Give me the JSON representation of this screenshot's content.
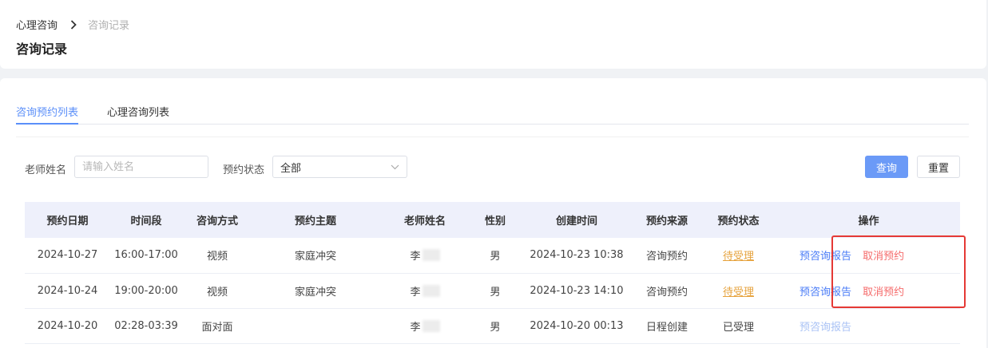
{
  "breadcrumb": {
    "parent": "心理咨询",
    "current": "咨询记录"
  },
  "page_title": "咨询记录",
  "tabs": [
    {
      "label": "咨询预约列表",
      "active": true
    },
    {
      "label": "心理咨询列表",
      "active": false
    }
  ],
  "filters": {
    "teacher_label": "老师姓名",
    "teacher_placeholder": "请输入姓名",
    "teacher_value": "",
    "status_label": "预约状态",
    "status_value": "全部",
    "search_label": "查询",
    "reset_label": "重置"
  },
  "table": {
    "columns": [
      "预约日期",
      "时间段",
      "咨询方式",
      "预约主题",
      "老师姓名",
      "性别",
      "创建时间",
      "预约来源",
      "预约状态",
      "操作"
    ],
    "rows": [
      {
        "date": "2024-10-27",
        "period": "16:00-17:00",
        "method": "视频",
        "topic": "家庭冲突",
        "teacher": "李",
        "gender": "男",
        "created": "2024-10-23 10:38",
        "source": "咨询预约",
        "status": "待受理",
        "ops": {
          "report": "预咨询报告",
          "cancel": "取消预约"
        }
      },
      {
        "date": "2024-10-24",
        "period": "19:00-20:00",
        "method": "视频",
        "topic": "家庭冲突",
        "teacher": "李",
        "gender": "男",
        "created": "2024-10-23 14:10",
        "source": "咨询预约",
        "status": "待受理",
        "ops": {
          "report": "预咨询报告",
          "cancel": "取消预约"
        }
      },
      {
        "date": "2024-10-20",
        "period": "02:28-03:39",
        "method": "面对面",
        "topic": "",
        "teacher": "李",
        "gender": "男",
        "created": "2024-10-20 00:13",
        "source": "日程创建",
        "status": "已受理",
        "ops": {
          "report": "预咨询报告"
        }
      }
    ]
  },
  "colors": {
    "primary": "#6b9af7",
    "pending": "#e6a23c",
    "cancel": "#f56c6c",
    "highlight": "#e53935"
  }
}
